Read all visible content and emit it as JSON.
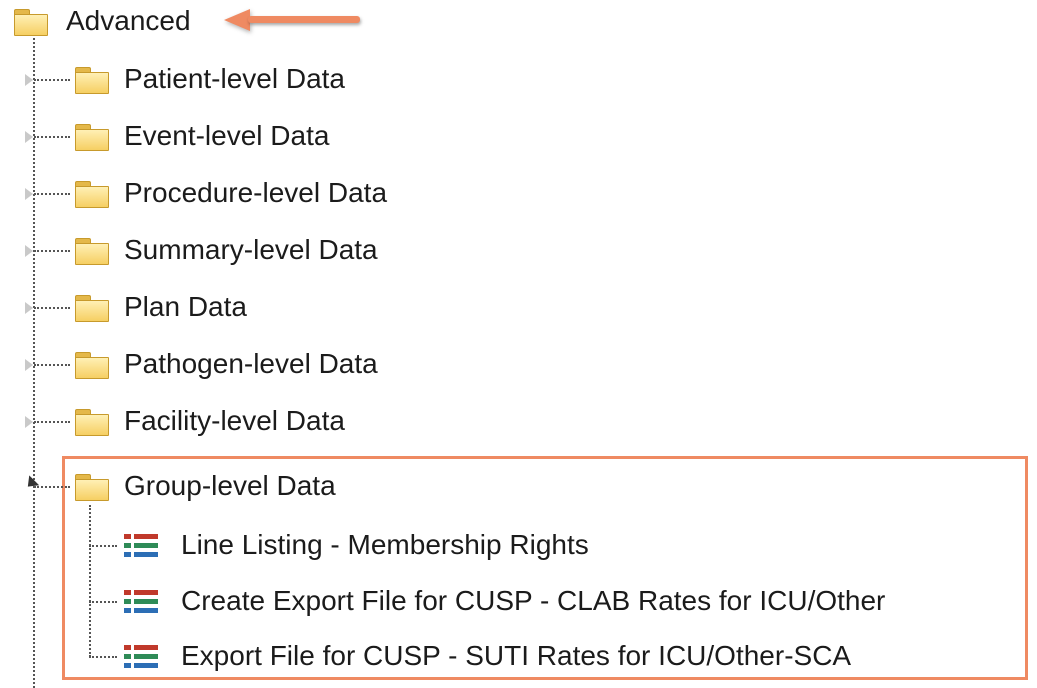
{
  "tree": {
    "root": {
      "label": "Advanced"
    },
    "folders": [
      {
        "label": "Patient-level Data"
      },
      {
        "label": "Event-level Data"
      },
      {
        "label": "Procedure-level Data"
      },
      {
        "label": "Summary-level Data"
      },
      {
        "label": "Plan Data"
      },
      {
        "label": "Pathogen-level Data"
      },
      {
        "label": "Facility-level Data"
      }
    ],
    "expanded_folder": {
      "label": "Group-level Data",
      "reports": [
        {
          "label": "Line Listing - Membership Rights"
        },
        {
          "label": "Create Export File for CUSP - CLAB Rates for ICU/Other"
        },
        {
          "label": "Export File for CUSP - SUTI Rates for ICU/Other-SCA"
        }
      ]
    }
  },
  "colors": {
    "highlight": "#ef8a62",
    "folder": "#f6cf63",
    "report_bullets": [
      "#c0392b",
      "#2e8b57",
      "#2c6eb5"
    ]
  },
  "icons": {
    "folder": "folder-icon",
    "report": "report-list-icon",
    "collapsed": "expand-triangle-icon",
    "expanded": "collapse-triangle-icon",
    "annotation": "arrow-left-icon"
  }
}
